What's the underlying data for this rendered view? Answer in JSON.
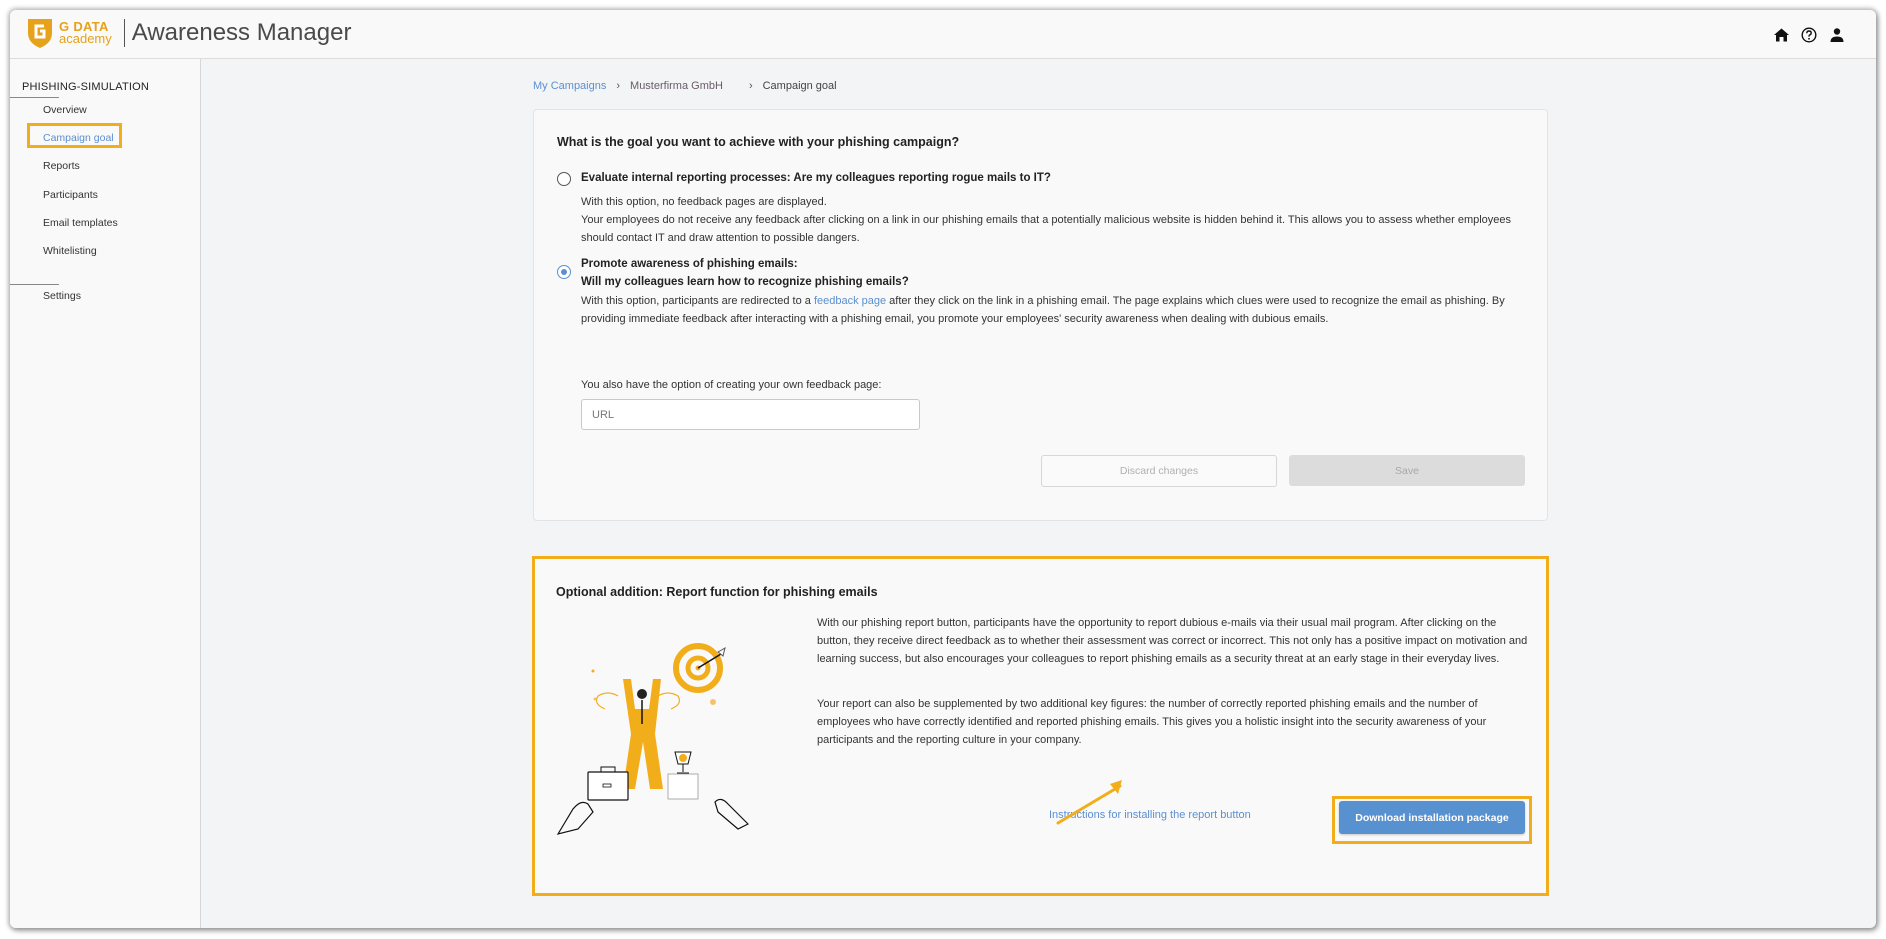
{
  "header": {
    "logo_line1": "G DATA",
    "logo_line2": "academy",
    "app_title": "Awareness Manager",
    "icons": [
      "home-icon",
      "help-icon",
      "user-icon"
    ]
  },
  "sidebar": {
    "section_title": "PHISHING-SIMULATION",
    "items": [
      {
        "label": "Overview",
        "active": false
      },
      {
        "label": "Campaign goal",
        "active": true
      },
      {
        "label": "Reports",
        "active": false
      },
      {
        "label": "Participants",
        "active": false
      },
      {
        "label": "Email templates",
        "active": false
      },
      {
        "label": "Whitelisting",
        "active": false
      }
    ],
    "settings_label": "Settings"
  },
  "breadcrumb": {
    "items": [
      "My Campaigns",
      "Musterfirma GmbH",
      "Campaign goal"
    ]
  },
  "goal_card": {
    "question": "What is the goal you want to achieve with your phishing campaign?",
    "option1": {
      "selected": false,
      "title": "Evaluate internal reporting processes: Are my colleagues reporting rogue mails to IT?",
      "line1": "With this option, no feedback pages are displayed.",
      "line2": "Your employees do not receive any feedback after clicking on a link in our phishing emails that a potentially malicious website is hidden behind it. This allows you to assess whether employees should contact IT and draw attention to possible dangers."
    },
    "option2": {
      "selected": true,
      "title_line1": "Promote awareness of phishing emails:",
      "title_line2": "Will my colleagues learn how to recognize phishing emails?",
      "text_before_link": "With this option, participants are redirected to a ",
      "link_text": "feedback page",
      "text_after_link": " after they click on the link in a phishing email. The page explains which clues were used to recognize the email as phishing. By providing immediate feedback after interacting with a phishing email, you promote your employees' security awareness when dealing with dubious emails."
    },
    "url_label": "You also have the option of creating your own feedback page:",
    "url_placeholder": "URL",
    "url_value": "",
    "discard_label": "Discard changes",
    "save_label": "Save"
  },
  "report_card": {
    "title": "Optional addition: Report function for phishing emails",
    "paragraph1": "With our phishing report button, participants have the opportunity to report dubious e-mails via their usual mail program. After clicking on the button, they receive direct feedback as to whether their assessment was correct or incorrect. This not only has a positive impact on motivation and learning success, but also encourages your colleagues to report phishing emails as a security threat at an early stage in their everyday lives.",
    "paragraph2": "Your report can also be supplemented by two additional key figures: the number of correctly reported phishing emails and the number of employees who have correctly identified and reported phishing emails. This gives you a holistic insight into the security awareness of your participants and the reporting culture in your company.",
    "instructions_link": "Instructions for installing the report button",
    "download_label": "Download installation package",
    "illustration": "celebrating-businessman-with-target-illustration"
  },
  "colors": {
    "accent": "#5b8fd0",
    "highlight": "#f2ae1a",
    "brand": "#e5a21a"
  }
}
